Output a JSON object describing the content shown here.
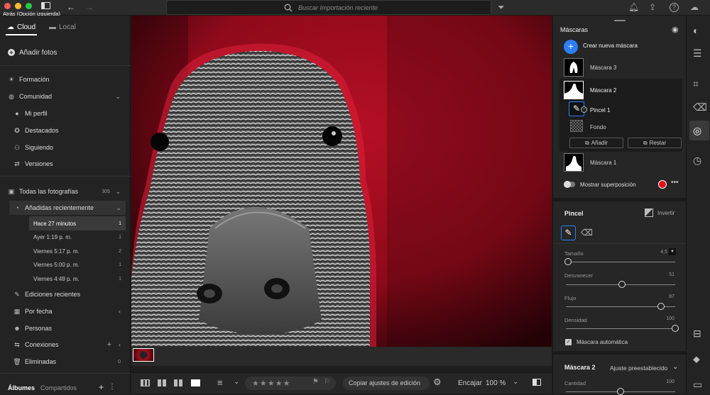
{
  "window": {
    "tooltip": "Atrás (Opción  izquierda)",
    "search_placeholder": "Buscar Importación reciente"
  },
  "left": {
    "tabs": [
      "Cloud",
      "Local"
    ],
    "add_photos": "Añadir fotos",
    "learn": "Formación",
    "community": "Comunidad",
    "community_items": [
      "Mi perfil",
      "Destacados",
      "Siguiendo",
      "Versiones"
    ],
    "all_photos": "Todas las fotografías",
    "all_photos_count": "305",
    "recently_added": "Añadidas recientemente",
    "recent_items": [
      {
        "label": "Hace 27 minutos",
        "count": "1"
      },
      {
        "label": "Ayer 1:19 p. m.",
        "count": "1"
      },
      {
        "label": "Viernes 5:17 p. m.",
        "count": "2"
      },
      {
        "label": "Viernes 5:00 p. m.",
        "count": "1"
      },
      {
        "label": "Viernes 4:49 p. m.",
        "count": "1"
      }
    ],
    "recent_edits": "Ediciones recientes",
    "by_date": "Por fecha",
    "people": "Personas",
    "connections": "Conexiones",
    "deleted": "Eliminadas",
    "deleted_count": "0",
    "bottom_tabs": [
      "Álbumes",
      "Compartidos"
    ]
  },
  "toolbar": {
    "stars": "★ ★ ★ ★ ★",
    "copy_settings": "Copiar ajustes de edición",
    "fit": "Encajar",
    "zoom": "100 %"
  },
  "masks": {
    "title": "Máscaras",
    "create": "Crear nueva máscara",
    "items": [
      "Máscara 3",
      "Máscara 2",
      "Máscara 1"
    ],
    "sub_items": [
      "Pincel 1",
      "Fondo"
    ],
    "add_label": "Añadir",
    "subtract_label": "Restar",
    "overlay": "Mostrar superposición",
    "overlay_color": "#e0101f"
  },
  "brush": {
    "title": "Pincel",
    "invert": "Invertir",
    "sliders": [
      {
        "label": "Tamaño",
        "value": "4,5",
        "pos": 0.02
      },
      {
        "label": "Desvanecer",
        "value": "51",
        "pos": 0.51
      },
      {
        "label": "Flujo",
        "value": "87",
        "pos": 0.87
      },
      {
        "label": "Densidad",
        "value": "100",
        "pos": 1.0
      }
    ],
    "auto_mask": "Máscara automática"
  },
  "mask2": {
    "title": "Máscara 2",
    "preset": "Ajuste preestablecido",
    "amount_label": "Cantidad",
    "amount_value": "100"
  }
}
